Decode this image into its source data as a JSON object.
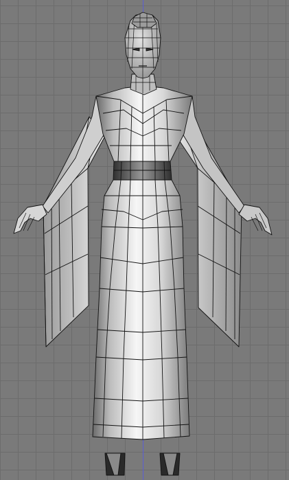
{
  "viewport": {
    "view": "front",
    "grid_visible": true,
    "colors": {
      "background": "#7a7a7a",
      "grid": "#6c6c6c",
      "axis_line": "#5a5ed6",
      "mesh_fill_light": "#f2f2f2",
      "mesh_fill_mid": "#b9b9b9",
      "mesh_fill_dark": "#5a5a5a",
      "wire": "#111111",
      "shoe": "#2a2a2a"
    }
  },
  "model": {
    "object": "character-mesh-dress-figure",
    "shading": "solid-with-wireframe"
  }
}
